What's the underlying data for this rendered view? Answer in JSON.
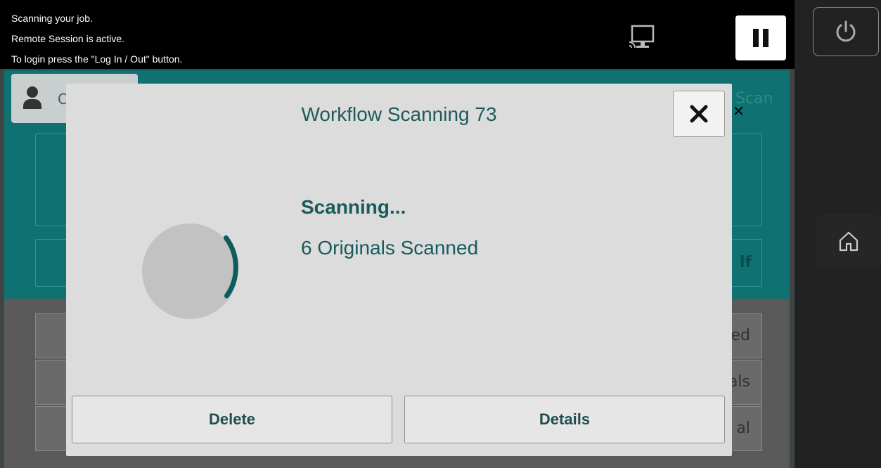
{
  "status_bar": {
    "lines": [
      "Scanning your job.",
      "Remote Session is active.",
      "To login press the \"Log In / Out\" button."
    ]
  },
  "background": {
    "user_label": "C",
    "scan_label": "Scan",
    "tiles": [
      "ed",
      "als",
      "al"
    ],
    "partial_label": "lf"
  },
  "modal": {
    "title": "Workflow Scanning 73",
    "status": "Scanning...",
    "count": "6 Originals Scanned",
    "delete_label": "Delete",
    "details_label": "Details"
  },
  "colors": {
    "teal": "#0f7171",
    "modal_text": "#195a5c",
    "spinner_arc": "#0f5c5c"
  },
  "icons": {
    "remote": "remote-session-icon",
    "pause": "pause-icon",
    "power": "power-icon",
    "home": "home-icon",
    "close": "close-icon"
  }
}
